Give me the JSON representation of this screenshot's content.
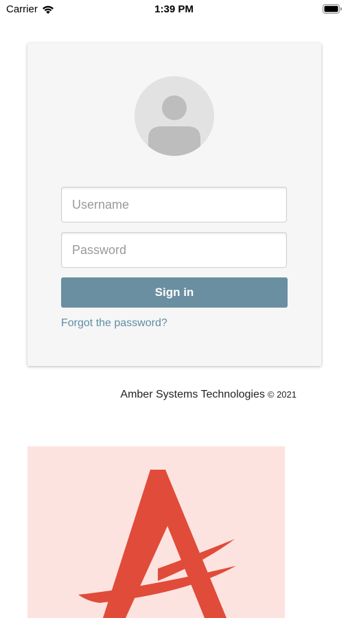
{
  "status_bar": {
    "carrier": "Carrier",
    "time": "1:39 PM",
    "icons": [
      "wifi-icon",
      "battery-icon"
    ]
  },
  "login": {
    "avatar_icon": "user-avatar-icon",
    "username_placeholder": "Username",
    "username_value": "",
    "password_placeholder": "Password",
    "password_value": "",
    "signin_label": "Sign in",
    "forgot_label": "Forgot the password?"
  },
  "footer": {
    "company": "Amber Systems Technologies",
    "copyright": "© 2021"
  },
  "logo": {
    "icon": "amber-logo-a-icon"
  },
  "colors": {
    "signin_button": "#6a8fa0",
    "link": "#5e8ea3",
    "logo_background": "#fde3df",
    "logo_mark": "#e04b3a",
    "card_background": "#f6f6f6"
  }
}
